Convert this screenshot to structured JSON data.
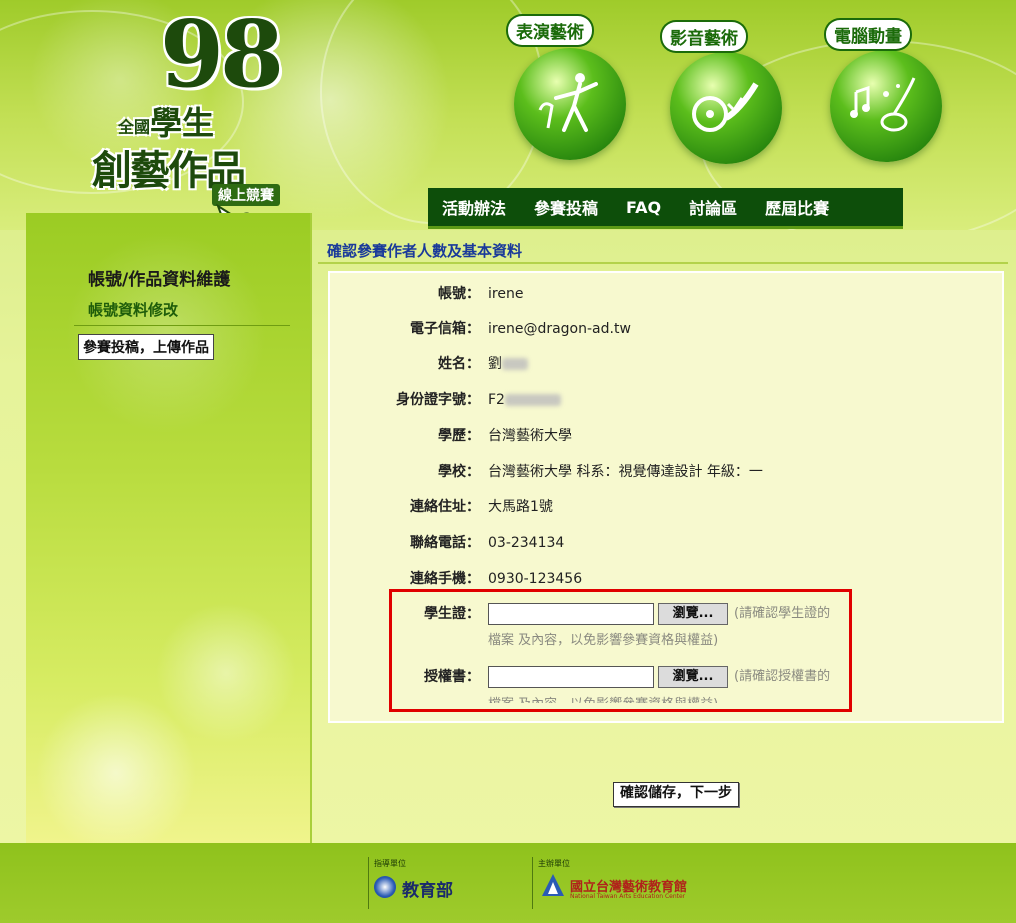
{
  "header": {
    "logo": {
      "number": "98",
      "line1_small": "全國",
      "line1": "學生",
      "line2": "創藝作品",
      "line3": "線上競賽"
    },
    "categories": [
      {
        "label": "表演藝術",
        "icon": "dancer-icon"
      },
      {
        "label": "影音藝術",
        "icon": "film-reel-icon"
      },
      {
        "label": "電腦動畫",
        "icon": "mouse-music-icon"
      }
    ],
    "nav": [
      "活動辦法",
      "參賽投稿",
      "FAQ",
      "討論區",
      "歷屆比賽"
    ]
  },
  "sidebar": {
    "title": "帳號/作品資料維護",
    "link": "帳號資料修改",
    "button": "參賽投稿，上傳作品"
  },
  "main": {
    "section_title": "確認參賽作者人數及基本資料",
    "fields": [
      {
        "label": "帳號：",
        "value": "irene"
      },
      {
        "label": "電子信箱：",
        "value": "irene@dragon-ad.tw"
      },
      {
        "label": "姓名：",
        "value": "劉"
      },
      {
        "label": "身份證字號：",
        "value": "F2"
      },
      {
        "label": "學歷：",
        "value": "台灣藝術大學"
      },
      {
        "label": "學校：",
        "value": "台灣藝術大學 科系：視覺傳達設計 年級：一"
      },
      {
        "label": "連絡住址：",
        "value": "大馬路1號"
      },
      {
        "label": "聯絡電話：",
        "value": "03-234134"
      },
      {
        "label": "連絡手機：",
        "value": "0930-123456"
      }
    ],
    "uploads": [
      {
        "label": "學生證：",
        "button": "瀏覽...",
        "note_line1": "(請確認學生證的",
        "note_line2": "檔案 及內容，以免影響參賽資格與權益)"
      },
      {
        "label": "授權書：",
        "button": "瀏覽...",
        "note_line1": "(請確認授權書的",
        "note_line2": "檔案 及內容，以免影響參賽資格與權益)"
      }
    ],
    "submit": "確認儲存，下一步"
  },
  "footer": {
    "sponsor1_label": "指導單位",
    "sponsor1_name": "教育部",
    "sponsor2_label": "主辦單位",
    "sponsor2_name": "國立台灣藝術教育館",
    "sponsor2_en": "National Taiwan Arts Education Center"
  },
  "colors": {
    "nav_bg": "#0d4e0a",
    "title_blue": "#1a3a9a",
    "highlight_red": "#e00000",
    "panel_bg": "#f7f9cf"
  }
}
